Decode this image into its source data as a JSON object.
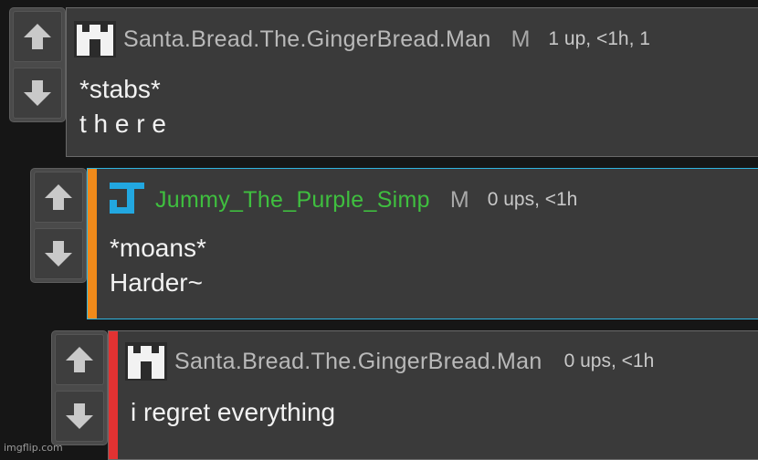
{
  "comments": [
    {
      "username": "Santa.Bread.The.GingerBread.Man",
      "badge": "M",
      "meta": "1 up, <1h, 1",
      "lines": [
        "*stabs*",
        "t h e r e"
      ],
      "username_color": "#b9b9b9",
      "avatar_icon": "castle-icon"
    },
    {
      "username": "Jummy_The_Purple_Simp",
      "badge": "M",
      "meta": "0 ups, <1h",
      "lines": [
        "*moans*",
        "Harder~"
      ],
      "username_color": "#3fbf3f",
      "bar_color": "#f08a1a",
      "highlight_border": "#2fb4e0",
      "avatar_icon": "letter-j-icon"
    },
    {
      "username": "Santa.Bread.The.GingerBread.Man",
      "meta": "0 ups, <1h",
      "lines": [
        "i regret everything"
      ],
      "username_color": "#b9b9b9",
      "bar_color": "#e23232",
      "avatar_icon": "castle-icon"
    }
  ],
  "vote_icons": {
    "up": "up-arrow-icon",
    "down": "down-arrow-icon"
  },
  "watermark": "imgflip.com"
}
